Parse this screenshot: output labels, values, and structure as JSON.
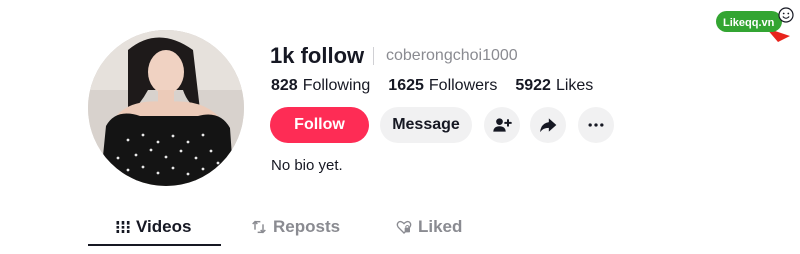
{
  "profile": {
    "name": "1k follow",
    "handle": "coberongchoi1000",
    "bio": "No bio yet."
  },
  "stats": {
    "following_count": "828",
    "following_label": "Following",
    "followers_count": "1625",
    "followers_label": "Followers",
    "likes_count": "5922",
    "likes_label": "Likes"
  },
  "actions": {
    "follow_label": "Follow",
    "message_label": "Message",
    "add_friend_icon": "person-add-icon",
    "share_icon": "share-arrow-icon",
    "more_icon": "more-dots-icon"
  },
  "tabs": [
    {
      "label": "Videos",
      "icon": "grid-icon",
      "active": true
    },
    {
      "label": "Reposts",
      "icon": "repost-icon",
      "active": false
    },
    {
      "label": "Liked",
      "icon": "heart-lock-icon",
      "active": false
    }
  ],
  "watermark": {
    "brand": "Likeqq.vn"
  },
  "colors": {
    "follow_button": "#fe2c55",
    "secondary_button": "#f1f1f2",
    "primary_text": "#161823",
    "muted_text": "#8a8b91",
    "watermark_green": "#33a532",
    "watermark_red": "#e8231c"
  }
}
